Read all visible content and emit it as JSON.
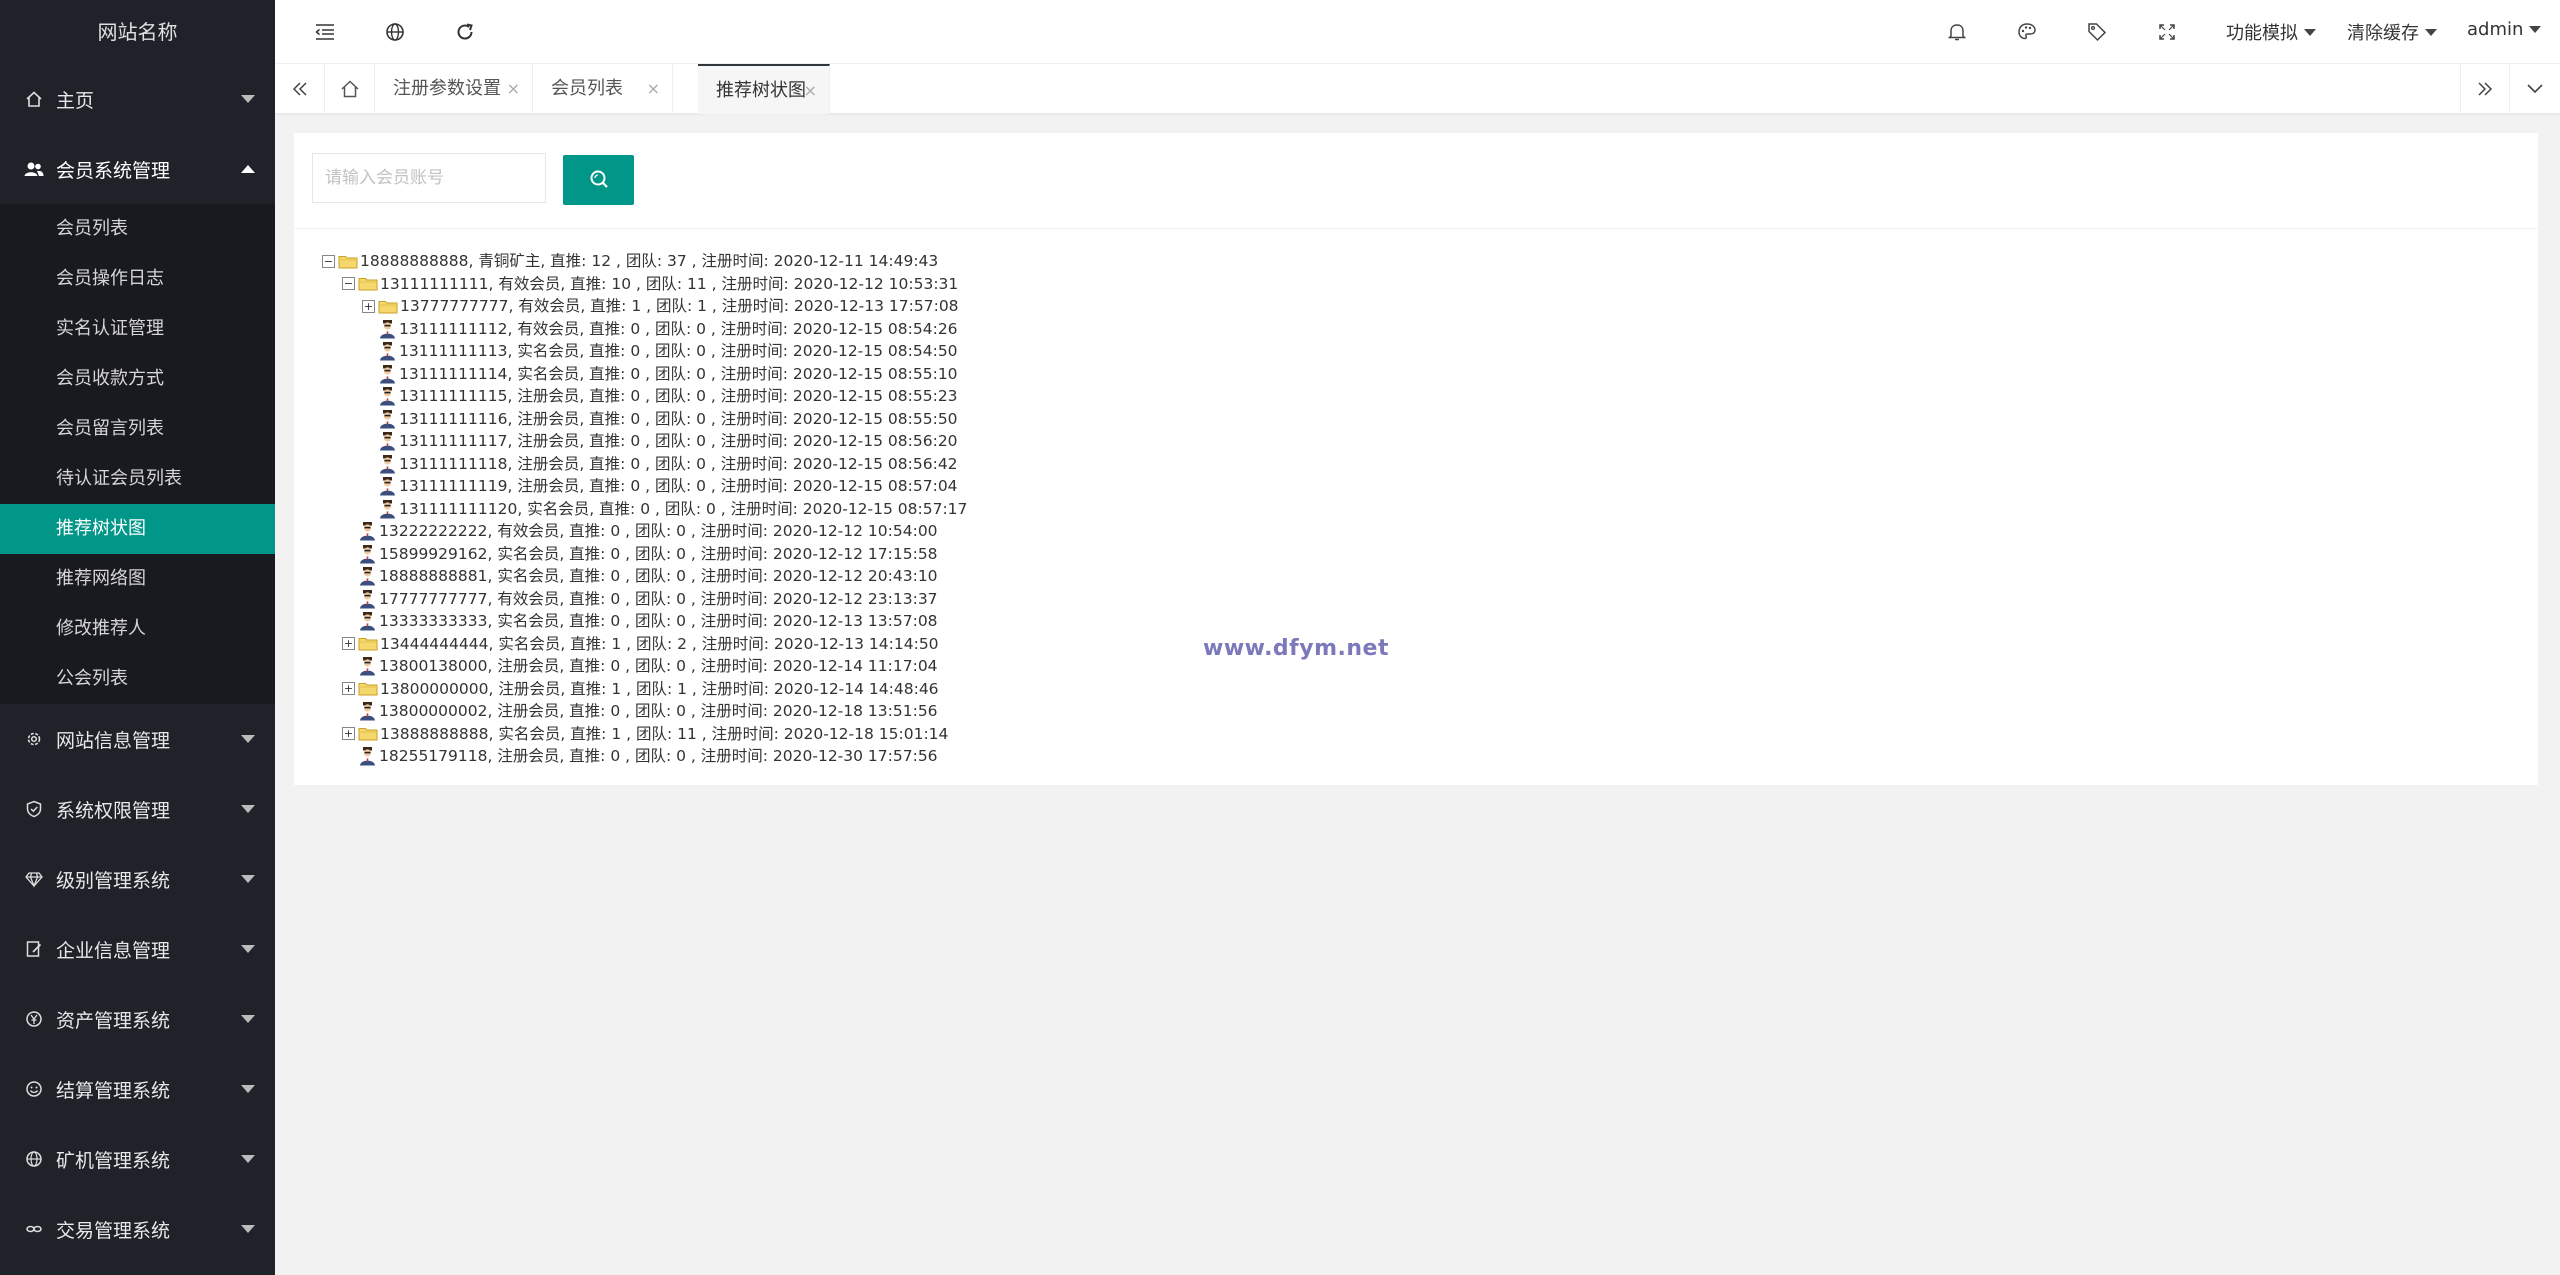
{
  "sidebar": {
    "logo": "网站名称",
    "menus": [
      {
        "label": "主页",
        "icon": "home-icon"
      },
      {
        "label": "会员系统管理",
        "icon": "users-icon",
        "open": true,
        "items": [
          "会员列表",
          "会员操作日志",
          "实名认证管理",
          "会员收款方式",
          "会员留言列表",
          "待认证会员列表",
          "推荐树状图",
          "推荐网络图",
          "修改推荐人",
          "公会列表"
        ],
        "active": "推荐树状图"
      },
      {
        "label": "网站信息管理",
        "icon": "gear-icon"
      },
      {
        "label": "系统权限管理",
        "icon": "shield-icon"
      },
      {
        "label": "级别管理系统",
        "icon": "diamond-icon"
      },
      {
        "label": "企业信息管理",
        "icon": "edit-document-icon"
      },
      {
        "label": "资产管理系统",
        "icon": "yen-icon"
      },
      {
        "label": "结算管理系统",
        "icon": "smile-icon"
      },
      {
        "label": "矿机管理系统",
        "icon": "globe-icon"
      },
      {
        "label": "交易管理系统",
        "icon": "link-icon"
      }
    ]
  },
  "header": {
    "menus": [
      "功能模拟",
      "清除缓存",
      "admin"
    ]
  },
  "tabs": [
    {
      "label": "注册参数设置",
      "close": "×"
    },
    {
      "label": "会员列表",
      "close": "×"
    },
    {
      "label": "推荐树状图",
      "close": "×",
      "active": true
    }
  ],
  "search": {
    "placeholder": "请输入会员账号",
    "value": ""
  },
  "tree": [
    {
      "depth": 0,
      "toggle": "−",
      "type": "folder",
      "text": "18888888888, 青铜矿主, 直推: 12 , 团队: 37 , 注册时间: 2020-12-11 14:49:43"
    },
    {
      "depth": 1,
      "toggle": "−",
      "type": "folder",
      "text": "13111111111, 有效会员, 直推: 10 , 团队: 11 , 注册时间: 2020-12-12 10:53:31"
    },
    {
      "depth": 2,
      "toggle": "+",
      "type": "folder",
      "text": "13777777777, 有效会员, 直推: 1 , 团队: 1 , 注册时间: 2020-12-13 17:57:08"
    },
    {
      "depth": 2,
      "toggle": "",
      "type": "person",
      "text": "13111111112, 有效会员, 直推: 0 , 团队: 0 , 注册时间: 2020-12-15 08:54:26"
    },
    {
      "depth": 2,
      "toggle": "",
      "type": "person",
      "text": "13111111113, 实名会员, 直推: 0 , 团队: 0 , 注册时间: 2020-12-15 08:54:50"
    },
    {
      "depth": 2,
      "toggle": "",
      "type": "person",
      "text": "13111111114, 实名会员, 直推: 0 , 团队: 0 , 注册时间: 2020-12-15 08:55:10"
    },
    {
      "depth": 2,
      "toggle": "",
      "type": "person",
      "text": "13111111115, 注册会员, 直推: 0 , 团队: 0 , 注册时间: 2020-12-15 08:55:23"
    },
    {
      "depth": 2,
      "toggle": "",
      "type": "person",
      "text": "13111111116, 注册会员, 直推: 0 , 团队: 0 , 注册时间: 2020-12-15 08:55:50"
    },
    {
      "depth": 2,
      "toggle": "",
      "type": "person",
      "text": "13111111117, 注册会员, 直推: 0 , 团队: 0 , 注册时间: 2020-12-15 08:56:20"
    },
    {
      "depth": 2,
      "toggle": "",
      "type": "person",
      "text": "13111111118, 注册会员, 直推: 0 , 团队: 0 , 注册时间: 2020-12-15 08:56:42"
    },
    {
      "depth": 2,
      "toggle": "",
      "type": "person",
      "text": "13111111119, 注册会员, 直推: 0 , 团队: 0 , 注册时间: 2020-12-15 08:57:04"
    },
    {
      "depth": 2,
      "toggle": "",
      "type": "person",
      "text": "131111111120, 实名会员, 直推: 0 , 团队: 0 , 注册时间: 2020-12-15 08:57:17"
    },
    {
      "depth": 1,
      "toggle": "",
      "type": "person",
      "text": "13222222222, 有效会员, 直推: 0 , 团队: 0 , 注册时间: 2020-12-12 10:54:00"
    },
    {
      "depth": 1,
      "toggle": "",
      "type": "person",
      "text": "15899929162, 实名会员, 直推: 0 , 团队: 0 , 注册时间: 2020-12-12 17:15:58"
    },
    {
      "depth": 1,
      "toggle": "",
      "type": "person",
      "text": "18888888881, 实名会员, 直推: 0 , 团队: 0 , 注册时间: 2020-12-12 20:43:10"
    },
    {
      "depth": 1,
      "toggle": "",
      "type": "person",
      "text": "17777777777, 有效会员, 直推: 0 , 团队: 0 , 注册时间: 2020-12-12 23:13:37"
    },
    {
      "depth": 1,
      "toggle": "",
      "type": "person",
      "text": "13333333333, 实名会员, 直推: 0 , 团队: 0 , 注册时间: 2020-12-13 13:57:08"
    },
    {
      "depth": 1,
      "toggle": "+",
      "type": "folder",
      "text": "13444444444, 实名会员, 直推: 1 , 团队: 2 , 注册时间: 2020-12-13 14:14:50"
    },
    {
      "depth": 1,
      "toggle": "",
      "type": "person",
      "text": "13800138000, 注册会员, 直推: 0 , 团队: 0 , 注册时间: 2020-12-14 11:17:04"
    },
    {
      "depth": 1,
      "toggle": "+",
      "type": "folder",
      "text": "13800000000, 注册会员, 直推: 1 , 团队: 1 , 注册时间: 2020-12-14 14:48:46"
    },
    {
      "depth": 1,
      "toggle": "",
      "type": "person",
      "text": "13800000002, 注册会员, 直推: 0 , 团队: 0 , 注册时间: 2020-12-18 13:51:56"
    },
    {
      "depth": 1,
      "toggle": "+",
      "type": "folder",
      "text": "13888888888, 实名会员, 直推: 1 , 团队: 11 , 注册时间: 2020-12-18 15:01:14"
    },
    {
      "depth": 1,
      "toggle": "",
      "type": "person",
      "text": "18255179118, 注册会员, 直推: 0 , 团队: 0 , 注册时间: 2020-12-30 17:57:56"
    }
  ],
  "watermark": "www.dfym.net",
  "colors": {
    "accent": "#009688",
    "sidebar": "#20222a",
    "submenu": "#181a1f"
  }
}
